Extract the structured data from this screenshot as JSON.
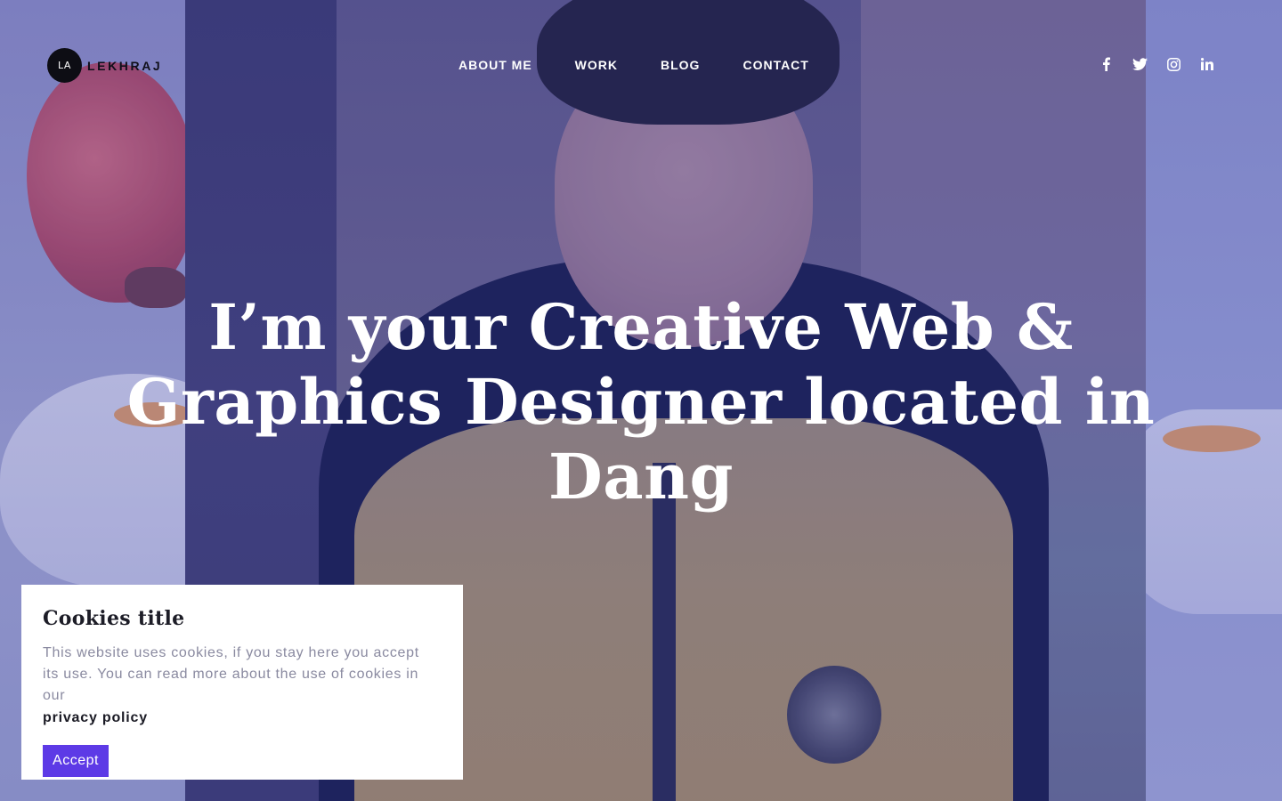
{
  "brand": {
    "logo_mark": "LA",
    "logo_text": "LEKHRAJ"
  },
  "nav": {
    "items": [
      {
        "label": "ABOUT ME"
      },
      {
        "label": "WORK"
      },
      {
        "label": "BLOG"
      },
      {
        "label": "CONTACT"
      }
    ]
  },
  "social": {
    "icons": [
      "facebook-icon",
      "twitter-icon",
      "instagram-icon",
      "linkedin-icon"
    ],
    "color": "#ffffff"
  },
  "hero": {
    "headline_line1": "I’m your Creative Web &",
    "headline_line2": "Graphics Designer located in",
    "headline_line3": "Dang"
  },
  "cookie_notice": {
    "title": "Cookies title",
    "body": "This website uses cookies, if you stay here you accept its use. You can read more about the use of cookies in our",
    "link_label": "privacy policy",
    "accept_label": "Accept",
    "accent_color": "#5d3ae6"
  }
}
